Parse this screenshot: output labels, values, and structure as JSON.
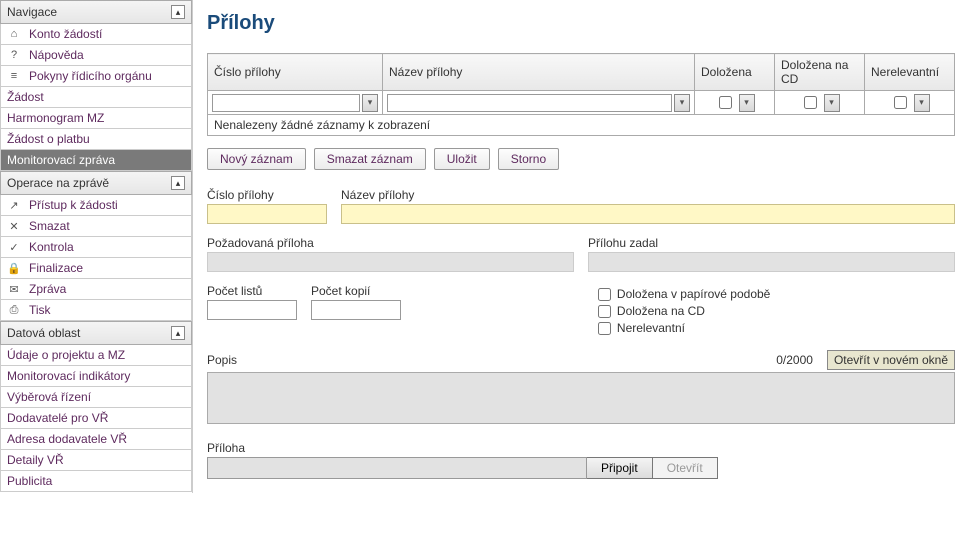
{
  "sidebar": {
    "navHeader": "Navigace",
    "navItems": [
      {
        "icon": "⌂",
        "label": "Konto žádostí"
      },
      {
        "icon": "?",
        "label": "Nápověda"
      },
      {
        "icon": "≡",
        "label": "Pokyny řídicího orgánu"
      }
    ],
    "plain1": [
      {
        "label": "Žádost"
      },
      {
        "label": "Harmonogram MZ"
      },
      {
        "label": "Žádost o platbu"
      },
      {
        "label": "Monitorovací zpráva",
        "selected": true
      }
    ],
    "opsHeader": "Operace na zprávě",
    "opsItems": [
      {
        "icon": "↗",
        "label": "Přístup k žádosti"
      },
      {
        "icon": "✕",
        "label": "Smazat"
      },
      {
        "icon": "✓",
        "label": "Kontrola"
      },
      {
        "icon": "🔒",
        "label": "Finalizace"
      },
      {
        "icon": "✉",
        "label": "Zpráva"
      },
      {
        "icon": "⎙",
        "label": "Tisk"
      }
    ],
    "dataHeader": "Datová oblast",
    "dataItems": [
      {
        "label": "Údaje o projektu a MZ"
      },
      {
        "label": "Monitorovací indikátory"
      },
      {
        "label": "Výběrová řízení"
      },
      {
        "label": "Dodavatelé pro VŘ"
      },
      {
        "label": "Adresa dodavatele VŘ"
      },
      {
        "label": "Detaily VŘ"
      },
      {
        "label": "Publicita"
      }
    ]
  },
  "page": {
    "title": "Přílohy"
  },
  "grid": {
    "headers": {
      "number": "Číslo přílohy",
      "name": "Název přílohy",
      "provided": "Doložena",
      "providedOnCD": "Doložena na CD",
      "irrelevant": "Nerelevantní"
    },
    "statusText": "Nenalezeny žádné záznamy k zobrazení"
  },
  "toolbar": {
    "newRecord": "Nový záznam",
    "deleteRecord": "Smazat záznam",
    "save": "Uložit",
    "cancel": "Storno"
  },
  "form": {
    "numberLabel": "Číslo přílohy",
    "nameLabel": "Název přílohy",
    "requiredLabel": "Požadovaná příloha",
    "enteredByLabel": "Přílohu zadal",
    "pagesLabel": "Počet listů",
    "copiesLabel": "Počet kopií",
    "chkPaper": "Doložena v papírové podobě",
    "chkCD": "Doložena na CD",
    "chkIrrelevant": "Nerelevantní",
    "descLabel": "Popis",
    "descCounter": "0/2000",
    "openNew": "Otevřít v novém okně",
    "attachLabel": "Příloha",
    "attachBtn": "Připojit",
    "openBtn": "Otevřít"
  }
}
